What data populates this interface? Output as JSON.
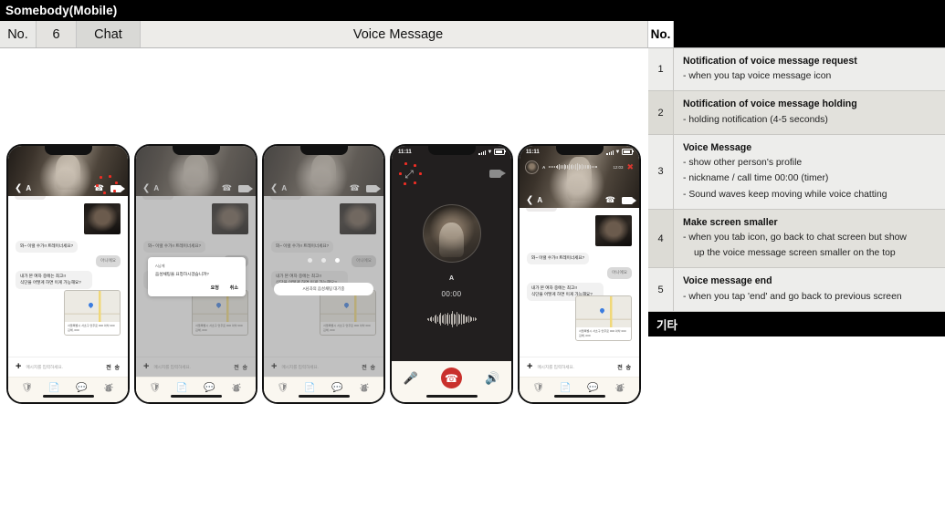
{
  "titlebar": {
    "title": "Somebody(Mobile)"
  },
  "left_header": {
    "no_label": "No.",
    "no_value": "6",
    "category": "Chat",
    "screen_title": "Voice Message"
  },
  "right_header": {
    "no_label": "No.",
    "blank": ""
  },
  "steps": [
    {
      "no": "1",
      "title": "Notification of voice message request",
      "lines": [
        "-  when you tap voice message icon"
      ]
    },
    {
      "no": "2",
      "title": "Notification of voice message holding",
      "lines": [
        "-  holding notification (4-5 seconds)"
      ]
    },
    {
      "no": "3",
      "title": "Voice Message",
      "lines": [
        "-   show other person's profile",
        "-  nickname / call time 00:00 (timer)",
        "-    Sound waves keep moving while voice chatting"
      ]
    },
    {
      "no": "4",
      "title": "Make screen smaller",
      "lines": [
        "-  when you tab icon, go back to chat screen but show",
        "up the voice message screen smaller on the top"
      ]
    },
    {
      "no": "5",
      "title": "Voice message end",
      "lines": [
        "-  when you tap 'end' and go back to previous screen"
      ]
    }
  ],
  "right_footer": {
    "label": "기타"
  },
  "chat": {
    "status_time": "11:11",
    "nickname": "A",
    "back_icon": "❮",
    "call_icon": "📞",
    "clip_text": "",
    "messages": [
      {
        "side": "in",
        "text": "와~ 이럴 수가!! 트레이너세요?"
      },
      {
        "side": "out",
        "text": "아니에요"
      },
      {
        "side": "in",
        "text": "내가 본 여자 중에는 최고!!\n식단을 어떻게 하면 이게 가능해요?"
      }
    ],
    "map_caption": "서울특별시 서초구 언주로 000 아차 000\n김해, 000",
    "input_placeholder": "메시지를 입력하세요.",
    "send_label": "전 송",
    "tabs": [
      "shield-icon",
      "cards-icon",
      "chat-icon",
      "person-icon"
    ]
  },
  "dialog": {
    "line1": "A님께",
    "line2": "음성채팅을 요청하시겠습니까?",
    "confirm": "요청",
    "cancel": "취소"
  },
  "holding": {
    "toast": "A님과의 음성채팅 대기중",
    "dots": 3
  },
  "call": {
    "status_time": "11:11",
    "name": "A",
    "timer": "00:00",
    "minimize_icon": "⤢",
    "video_icon": "video-camera-icon",
    "mute_icon": "🎤",
    "end_icon": "end-call-icon",
    "speaker_icon": "🔊"
  },
  "minibar": {
    "name": "A",
    "timer": "12:03",
    "end_icon": "end-call-icon"
  },
  "colors": {
    "accent_red": "#ef2d24",
    "end_call_red": "#c9302c",
    "header_black": "#000000",
    "row_odd": "#ededeb",
    "row_even": "#e2e1dc"
  }
}
